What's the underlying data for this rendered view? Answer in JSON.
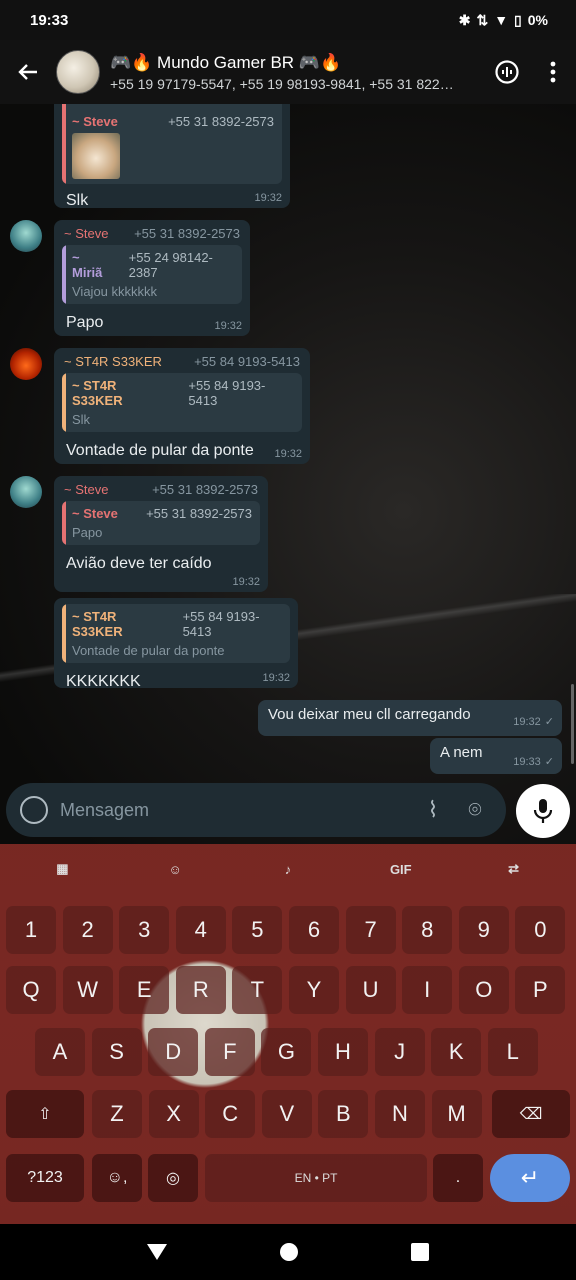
{
  "status_bar": {
    "time": "19:33",
    "battery": "0%"
  },
  "header": {
    "group_name": "🎮🔥 Mundo Gamer BR 🎮🔥",
    "members": "+55 19 97179-5547, +55 19 98193-9841, +55 31 822…"
  },
  "messages": [
    {
      "sender": "~ Steve",
      "phone": "+55 31 8392-2573",
      "text": "Slk",
      "time": "19:32"
    },
    {
      "sender": "~ Steve",
      "phone": "+55 31 8392-2573",
      "quote_name": "~ Miriã",
      "quote_phone": "+55 24 98142-2387",
      "quote_text": "Viajou kkkkkkk",
      "text": "Papo",
      "time": "19:32"
    },
    {
      "sender": "~ ST4R S33KER",
      "phone": "+55 84 9193-5413",
      "quote_name": "~ ST4R S33KER",
      "quote_phone": "+55 84 9193-5413",
      "quote_text": "Slk",
      "text": "Vontade de pular da ponte",
      "time": "19:32"
    },
    {
      "sender": "~ Steve",
      "phone": "+55 31 8392-2573",
      "quote_name": "~ Steve",
      "quote_phone": "+55 31 8392-2573",
      "quote_text": "Papo",
      "text": "Avião deve ter caído",
      "time": "19:32"
    },
    {
      "quote_name": "~ ST4R S33KER",
      "quote_phone": "+55 84 9193-5413",
      "quote_text": "Vontade de pular da ponte",
      "text": "KKKKKKK",
      "time": "19:32"
    },
    {
      "text": "Vou deixar meu cll carregando",
      "time": "19:32"
    },
    {
      "text": "A nem",
      "time": "19:33"
    }
  ],
  "input": {
    "placeholder": "Mensagem"
  },
  "keyboard": {
    "toolbar_gif": "GIF",
    "row1": [
      "1",
      "2",
      "3",
      "4",
      "5",
      "6",
      "7",
      "8",
      "9",
      "0"
    ],
    "row2": [
      "Q",
      "W",
      "E",
      "R",
      "T",
      "Y",
      "U",
      "I",
      "O",
      "P"
    ],
    "row3": [
      "A",
      "S",
      "D",
      "F",
      "G",
      "H",
      "J",
      "K",
      "L"
    ],
    "row4": [
      "Z",
      "X",
      "C",
      "V",
      "B",
      "N",
      "M"
    ],
    "symbols": "?123",
    "space": "EN • PT",
    "period": "."
  },
  "colors": {
    "steve": "#e57373",
    "star": "#f0b27a",
    "miria": "#b39ddb",
    "bubble_in": "#1f2c33",
    "bubble_out": "#2a3942"
  }
}
